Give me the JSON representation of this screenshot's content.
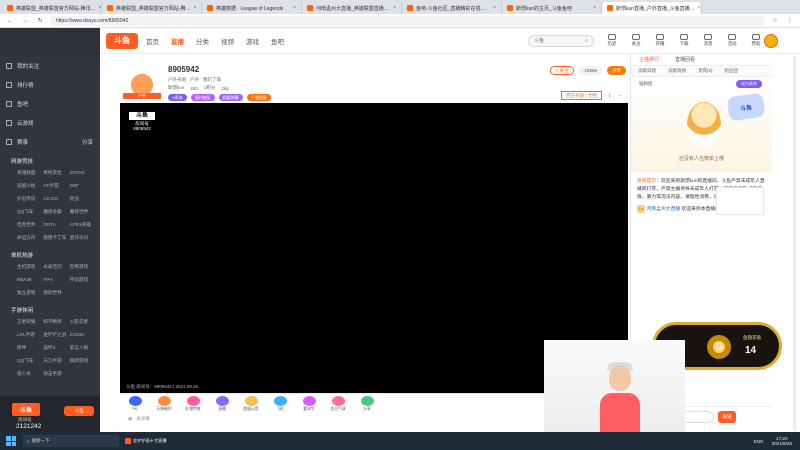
{
  "browser": {
    "tabs": [
      {
        "label": "英雄联盟_英雄联盟官方网站·腾讯…",
        "active": false
      },
      {
        "label": "英雄联盟_英雄联盟官方网站·腾…",
        "active": false
      },
      {
        "label": "英雄数据 · League of Legends",
        "active": false
      },
      {
        "label": "河南孟州大直播_英雄联盟直播…",
        "active": false
      },
      {
        "label": "鱼吧-斗鱼社区_直播精彩在线…",
        "active": false
      },
      {
        "label": "斯惯kun的主页_斗鱼鱼吧",
        "active": false
      },
      {
        "label": "斯惯kun直播_户外直播_斗鱼直播…",
        "active": true
      }
    ],
    "url": "https://www.douyu.com/8905942"
  },
  "header": {
    "logo": "斗鱼",
    "nav": [
      "首页",
      "直播",
      "分类",
      "视频",
      "游戏",
      "鱼吧"
    ],
    "search_placeholder": "斗鱼",
    "icons": [
      "历史",
      "关注",
      "开播",
      "下载",
      "消息",
      "活动",
      "赞助"
    ]
  },
  "sidebar": {
    "primary": [
      "我的关注",
      "排行榜",
      "鱼吧",
      "云游戏",
      "赛事",
      "分享"
    ],
    "groups": [
      {
        "title": "网游竞技",
        "items": [
          "英雄联盟",
          "绝地求生",
          "DOTA2",
          "穿越火线",
          "CF手游",
          "DNF",
          "炉石传说",
          "CS:GO",
          "逆战",
          "QQ飞车",
          "魔兽争霸",
          "魔兽世界",
          "坦克世界",
          "DOTA",
          "APEX英雄",
          "命运方舟",
          "跑跑卡丁车",
          "蛋仔派对"
        ]
      },
      {
        "title": "单机热游",
        "items": [
          "主机游戏",
          "永劫无间",
          "恐怖游戏",
          "NBA2K",
          "FIFA",
          "怀旧游戏",
          "独立游戏",
          "我的世界"
        ]
      },
      {
        "title": "手游休闲",
        "items": [
          "王者荣耀",
          "和平精英",
          "火影忍者",
          "LOL手游",
          "金铲铲之战",
          "CODM",
          "原神",
          "崩坏3",
          "第五人格",
          "QQ飞车",
          "天刀手游",
          "棋牌游戏",
          "狼人杀",
          "射击手游"
        ]
      }
    ],
    "bottom_logo": "斗鱼",
    "bottom_room_label": "房间号",
    "bottom_number": "2121242",
    "bottom_action": "斗鱼"
  },
  "room": {
    "avatar_caption": "户外",
    "title": "8905942",
    "category_line": "户外天地 · 户外 · 我们了现",
    "streamer": "斯惯kun",
    "stats": [
      "283",
      "1积分",
      "2kg"
    ],
    "follow": "+ 关注",
    "followers": "18866",
    "share": "分享",
    "vip": "V贵族",
    "tags": [
      "福利抽奖",
      "超级弹幕",
      "开播提醒"
    ],
    "banner": "百花齐放 | 文档"
  },
  "player": {
    "watermark_logo": "斗鱼",
    "watermark_room": "房间号",
    "watermark_number": "8905942",
    "footer": "斗鱼 房间号：8905942 | 2021.09.26"
  },
  "gifts": [
    "PK",
    "天降福利",
    "礼物特效",
    "直播",
    "超级火箭",
    "飞机",
    "嘉年华",
    "告白气球",
    "分享"
  ],
  "chat": {
    "main_tabs": [
      "主播排行",
      "直播回看"
    ],
    "sub_tabs": [
      "贡献日榜",
      "贡献周榜",
      "贵宾(5)",
      "粉丝团",
      "钻粉团",
      "守护团"
    ],
    "empty_text": "还没有人在榜单上哦",
    "vip_badge": "成为贵宾",
    "mascot_badge": "斗鱼",
    "system_prefix": "系统提示：",
    "system_text": "欢迎来到斯惯kun的直播间，斗鱼严禁未成年人直播或打赏，严禁主播诱导未成年人打赏，严禁任何形式的低俗、暴力等违法内容，请理性消费，谨防网络诈骗。",
    "user_level": "Lv",
    "user_name": "河南孟州大直播",
    "user_text": "欢迎来到本直播间",
    "input_placeholder": "发弹幕",
    "send": "发送"
  },
  "promo": {
    "label": "鱼翅充值",
    "count": "14"
  },
  "taskbar": {
    "search": "搜索一下",
    "app": "金铲铲段十大直播",
    "time": "17:20",
    "date": "2021/9/26",
    "lang": "ENG"
  }
}
